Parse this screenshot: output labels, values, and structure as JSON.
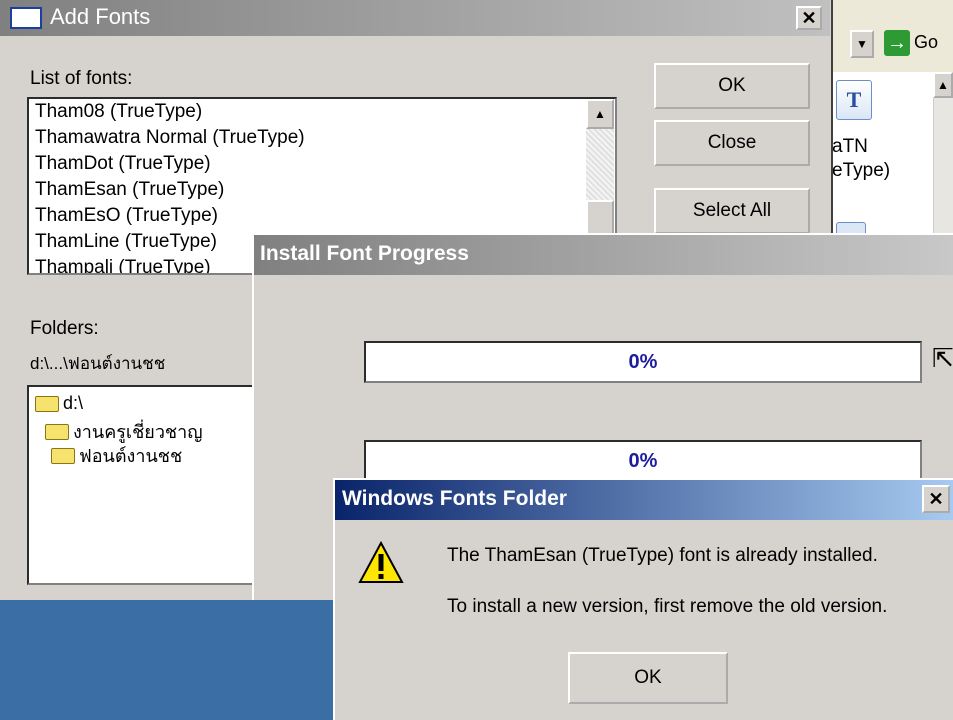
{
  "explorer": {
    "go_label": "Go",
    "file_name_line1": "aTN",
    "file_name_line2": "eType)",
    "icon": "truetype-font-file-icon"
  },
  "add_fonts": {
    "title": "Add Fonts",
    "list_label": "List of fonts:",
    "fonts": [
      "Tham08 (TrueType)",
      "Thamawatra Normal (TrueType)",
      "ThamDot (TrueType)",
      "ThamEsan (TrueType)",
      "ThamEsO (TrueType)",
      "ThamLine (TrueType)",
      "Thampali (TrueType)"
    ],
    "ok_label": "OK",
    "close_label": "Close",
    "select_all_label": "Select All",
    "folders_label": "Folders:",
    "current_path": "d:\\...\\ฟอนต์งานชช",
    "folder_tree": [
      "d:\\",
      "งานครูเชี่ยวชาญ",
      "ฟอนต์งานชช"
    ]
  },
  "progress": {
    "title": "Install Font Progress",
    "bar1_text": "0%",
    "bar2_text": "0%",
    "bar1_value": 0,
    "bar2_value": 0
  },
  "alert": {
    "title": "Windows Fonts Folder",
    "message_line1": "The ThamEsan (TrueType) font is already installed.",
    "message_line2": "To install a new version, first remove the old version.",
    "ok_label": "OK",
    "icon": "warning-icon"
  },
  "colors": {
    "desktop": "#3a6ea5",
    "active_title": "#0a246a",
    "inactive_title": "#808080",
    "dialog_face": "#d6d3ce"
  }
}
